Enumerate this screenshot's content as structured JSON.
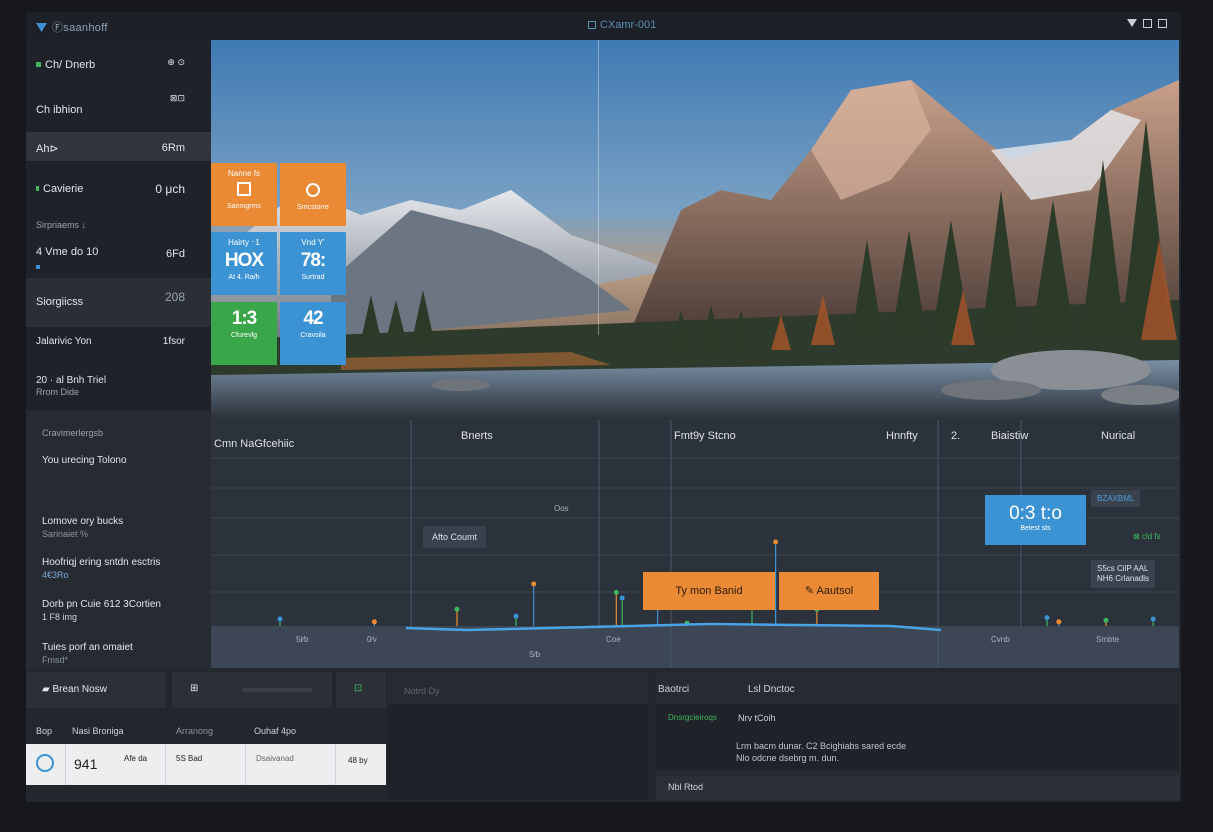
{
  "window": {
    "app_title": "Ⓕsaanhoff",
    "center_title": "CXamr-001"
  },
  "sidebar": {
    "rows": [
      {
        "label": "Ch/ Dnerb",
        "value": "⊕ ⊙"
      },
      {
        "label": "Ch ibhion",
        "value": "⊠⊡"
      },
      {
        "label": "Ah⊳",
        "value": "6Rm"
      },
      {
        "label": "Cavierie",
        "value": "0 μch"
      },
      {
        "label": "Sirpriaems ↓",
        "value": ""
      },
      {
        "label": "4 Vme do 10",
        "value": "6Fd"
      },
      {
        "label": "Siorgiicss",
        "value": "208"
      },
      {
        "label": "Jalarivic Yon",
        "value": "1fsor"
      },
      {
        "label": "20 · al Bnh Triel",
        "sub": "Rrom Dide"
      }
    ],
    "section_title": "Cravimerlergsb",
    "entries": [
      {
        "title": "You urecing Tolono",
        "sub": ""
      },
      {
        "title": "Lomove ory bucks",
        "sub": "Sarinaiet %"
      },
      {
        "title": "Hoofriqj ering sntdn esctris",
        "sub": "4€3Ro"
      },
      {
        "title": "Dorb pn Cuie 612 3Cortien",
        "sub": "1 F8 img"
      },
      {
        "title": "Tuies porf an omaiet",
        "sub": "Fmsd*"
      }
    ]
  },
  "tiles": [
    {
      "header": "Nanne fs",
      "footer": "Sanmgrms",
      "icon": "document-icon",
      "color": "#ea8a35"
    },
    {
      "header": "",
      "footer": "Smcstorre",
      "icon": "clock-icon",
      "color": "#ea8a35"
    },
    {
      "header": "Hairty ⁻1",
      "value": "HOX",
      "footer": "At 4. Ra/h",
      "color": "#3c93d4"
    },
    {
      "header": "Vnd Y'",
      "value": "78:",
      "footer": "Surtrad",
      "color": "#3c93d4"
    },
    {
      "header": "",
      "value": "1:3",
      "footer": "Cfurevlg",
      "color": "#3aa64a"
    },
    {
      "header": "",
      "value": "42",
      "footer": "Cravsila",
      "color": "#3c93d4"
    }
  ],
  "chart_panel": {
    "columns": [
      "Cmn NaGfcehiic",
      "Bnerts",
      "Fmt9y Stcno",
      "Hnnfty",
      "2.",
      "Biaistiw",
      "Nurical"
    ],
    "tags": {
      "alt_count": "Afto Coumt",
      "mid_label": "Oos",
      "side_top": "BZAXBML",
      "side_small": "⊠ cld fs",
      "side_box": "S5cs CilP AAL\nNH6 Crlanadls"
    },
    "buttons": {
      "primary": "Ty mon Banid",
      "secondary": "Aautsol"
    },
    "readout": {
      "value": "0:3 t:o",
      "sub": "Beiest sts"
    },
    "base_labels": [
      "5t⁄b",
      "0⁄v",
      "S⁄b",
      "Coe",
      "Cvnb",
      "Smbte"
    ]
  },
  "chart_data": {
    "type": "scatter",
    "title": "",
    "xlabel": "",
    "ylabel": "",
    "series": [
      {
        "name": "",
        "x": [
          50,
          130,
          200,
          250,
          265,
          335,
          340,
          370,
          395,
          450,
          470,
          505,
          700,
          710,
          750,
          790
        ],
        "y": [
          5,
          3,
          12,
          7,
          30,
          24,
          20,
          22,
          2,
          30,
          60,
          12,
          6,
          3,
          4,
          5
        ]
      }
    ]
  },
  "bottom": {
    "left_tabs": [
      "Brean Nosw",
      "⊞",
      "⊡"
    ],
    "row2": [
      "Bop",
      "Nasi Broniga",
      "Arranong",
      "Ouhaf 4po"
    ],
    "card": {
      "value": "941",
      "c2": "Afe da",
      "c3": "5S Bad",
      "c4": "Dsaivanad",
      "c5": "48 by"
    },
    "mid_label": "Notrd Dy",
    "right": {
      "h1": "Baotrci",
      "h2": "Lsl Dnctoc",
      "tag": "Dnsrgcieiroqs",
      "title": "Nrv tCoih",
      "line1": "Lrm bacm dunar. C2 Bcighiabs sared ecde",
      "line2": "Nlo odcne dsebrg m. dun.",
      "footer": "Nbl Rtod"
    }
  },
  "colors": {
    "accent_orange": "#ea8a35",
    "accent_blue": "#3c93d4",
    "accent_green": "#3aa64a",
    "bg_dark": "#22262d"
  }
}
